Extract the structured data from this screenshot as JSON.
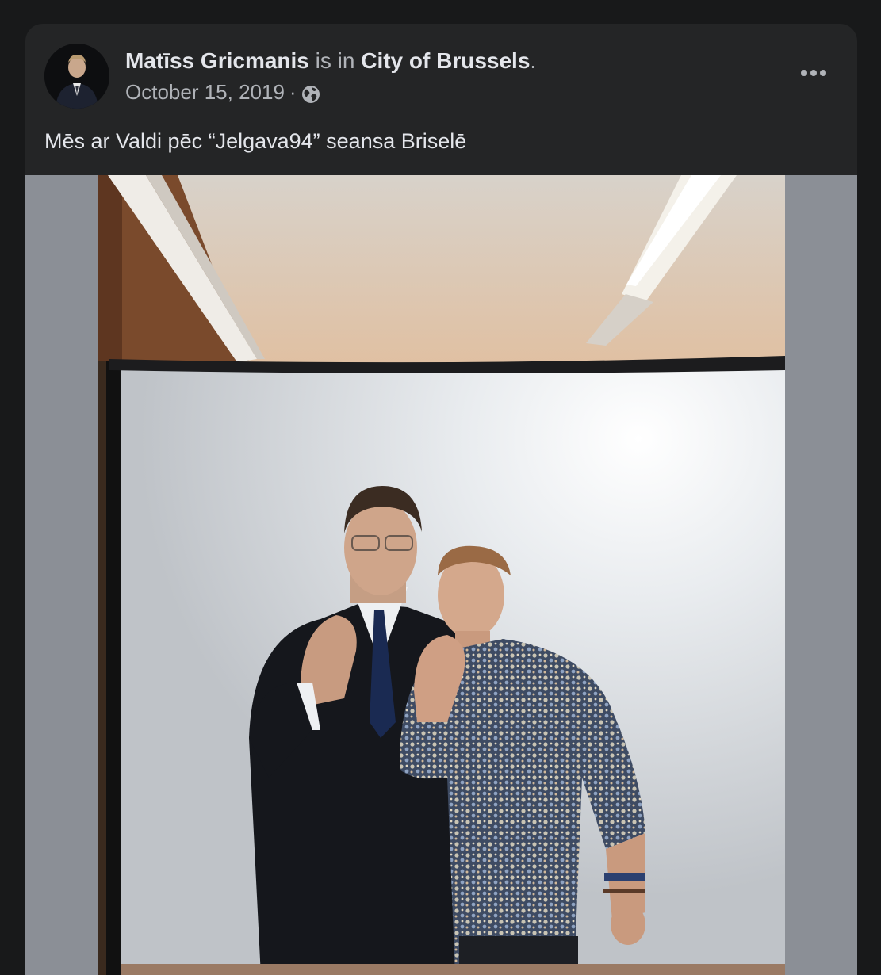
{
  "post": {
    "author": "Matīss Gricmanis",
    "location_connector": "is in",
    "location": "City of Brussels",
    "location_suffix": ".",
    "date": "October 15, 2019",
    "meta_separator": "·",
    "privacy_icon": "globe-icon",
    "more_icon": "more-horizontal-icon",
    "caption": "Mēs ar Valdi pēc “Jelgava94” seansa Briselē"
  },
  "colors": {
    "page_background": "#18191a",
    "card_background": "#242526",
    "primary_text": "#e4e6eb",
    "secondary_text": "#b0b3b8",
    "media_letterbox": "#8b8f96"
  }
}
